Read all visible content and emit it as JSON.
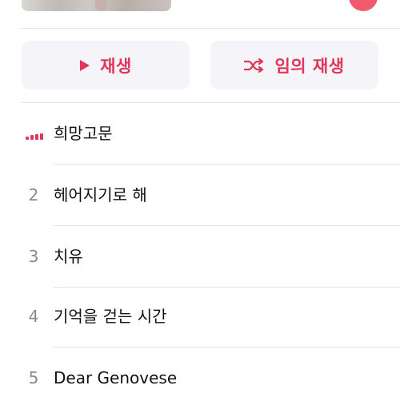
{
  "header": {
    "play_label": "재생",
    "shuffle_label": "임의 재생",
    "accent_color": "#e0365a"
  },
  "tracks": [
    {
      "number": "",
      "title": "희망고문",
      "playing": true
    },
    {
      "number": "2",
      "title": "헤어지기로 해",
      "playing": false
    },
    {
      "number": "3",
      "title": "치유",
      "playing": false
    },
    {
      "number": "4",
      "title": "기억을 걷는 시간",
      "playing": false
    },
    {
      "number": "5",
      "title": "Dear Genovese",
      "playing": false
    }
  ],
  "icons": [
    "play-icon",
    "shuffle-icon",
    "now-playing-bars-icon"
  ]
}
